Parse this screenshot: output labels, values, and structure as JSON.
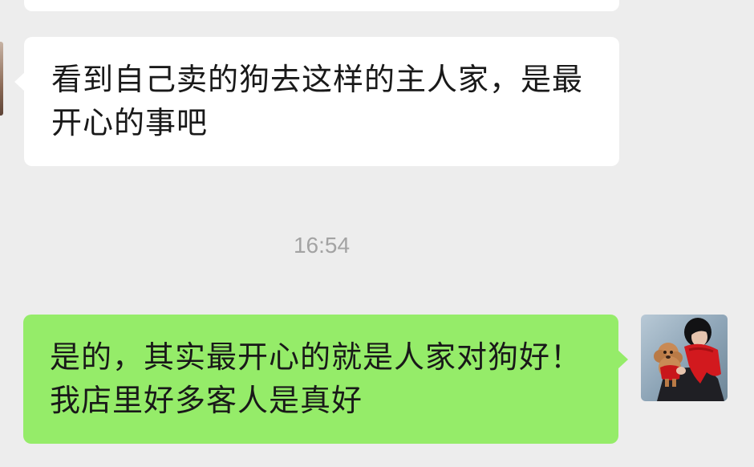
{
  "messages": [
    {
      "direction": "incoming",
      "text": "看到自己卖的狗去这样的主人家，是最开心的事吧"
    },
    {
      "direction": "outgoing",
      "text": "是的，其实最开心的就是人家对狗好！我店里好多客人是真好"
    }
  ],
  "timestamp": "16:54",
  "colors": {
    "background": "#ededed",
    "incoming_bubble": "#ffffff",
    "outgoing_bubble": "#95ec69",
    "timestamp_text": "#a3a3a3",
    "message_text": "#191919"
  },
  "avatars": {
    "right": "user-avatar-person-with-red-scarf-holding-poodle",
    "left": "contact-avatar-partial"
  }
}
